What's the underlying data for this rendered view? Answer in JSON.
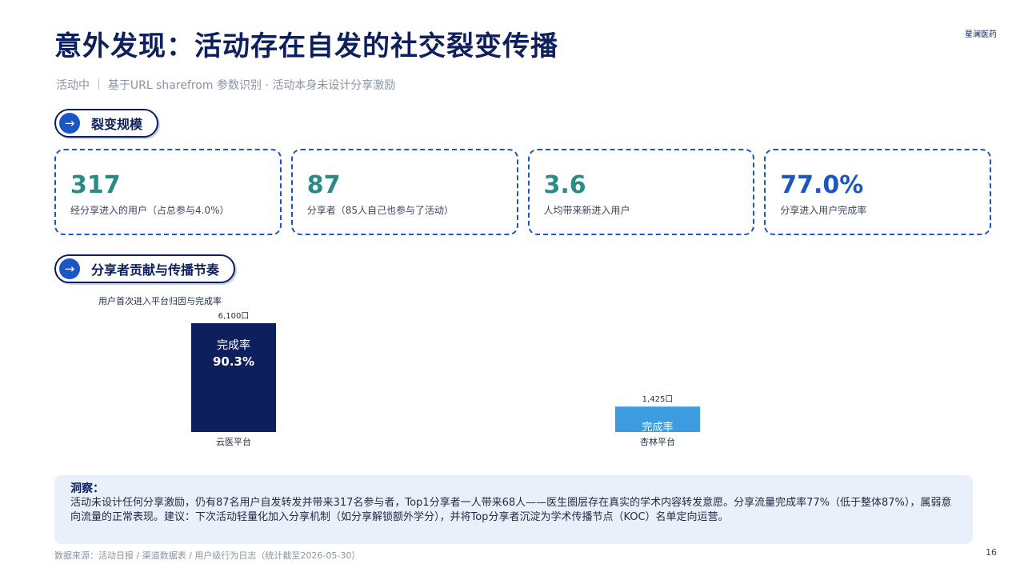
{
  "header": {
    "title": "意外发现：活动存在自发的社交裂变传播",
    "brand": "星澜医药",
    "subtitle": "活动中 ｜ 基于URL sharefrom 参数识别 · 活动本身未设计分享激励"
  },
  "sections": {
    "scale": {
      "arrow": "→",
      "label": "裂变规模"
    },
    "contrib": {
      "arrow": "→",
      "label": "分享者贡献与传播节奏"
    }
  },
  "kpis": [
    {
      "value": "317",
      "desc": "经分享进入的用户（占总参与4.0%）",
      "color": "#2a8a86"
    },
    {
      "value": "87",
      "desc": "分享者（85人自己也参与了活动）",
      "color": "#2a8a86"
    },
    {
      "value": "3.6",
      "desc": "人均带来新进入用户",
      "color": "#2a8a86"
    },
    {
      "value": "77.0%",
      "desc": "分享进入用户完成率",
      "color": "#1a56c4"
    }
  ],
  "chart_data": {
    "type": "bar",
    "title": "用户首次进入平台归因与完成率",
    "categories": [
      "云医平台",
      "杏林平台"
    ],
    "values": [
      6100,
      1425
    ],
    "value_labels": [
      "6,100口",
      "1,425口"
    ],
    "inner_label": "完成率",
    "completion_rates": [
      "90.3%",
      ""
    ],
    "colors": [
      "#0d1f5c",
      "#3d9be0"
    ],
    "ylim": [
      0,
      6100
    ]
  },
  "insight": {
    "head": "洞察：",
    "body": "活动未设计任何分享激励，仍有87名用户自发转发并带来317名参与者，Top1分享者一人带来68人——医生圈层存在真实的学术内容转发意愿。分享流量完成率77%（低于整体87%），属弱意向流量的正常表现。建议：下次活动轻量化加入分享机制（如分享解锁额外学分），并将Top分享者沉淀为学术传播节点（KOC）名单定向运营。"
  },
  "footer": {
    "source": "数据来源：活动日报 / 渠道数据表 / 用户级行为日志（统计截至2026-05-30）",
    "page": "16"
  }
}
